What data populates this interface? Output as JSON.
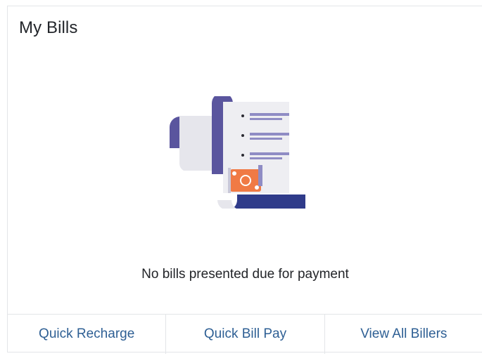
{
  "card": {
    "title": "My Bills",
    "illustration_icon": "bill-receipt-illustration",
    "empty_message": "No bills presented due for payment"
  },
  "footer": {
    "actions": [
      {
        "label": "Quick Recharge"
      },
      {
        "label": "Quick Bill Pay"
      },
      {
        "label": "View All Billers"
      }
    ]
  },
  "colors": {
    "title_text": "#23262b",
    "link": "#2e5f94",
    "border": "#e3e5e8",
    "illustration_primary": "#5a559e",
    "illustration_paper": "#eeeef2",
    "illustration_accent": "#f07a45"
  }
}
